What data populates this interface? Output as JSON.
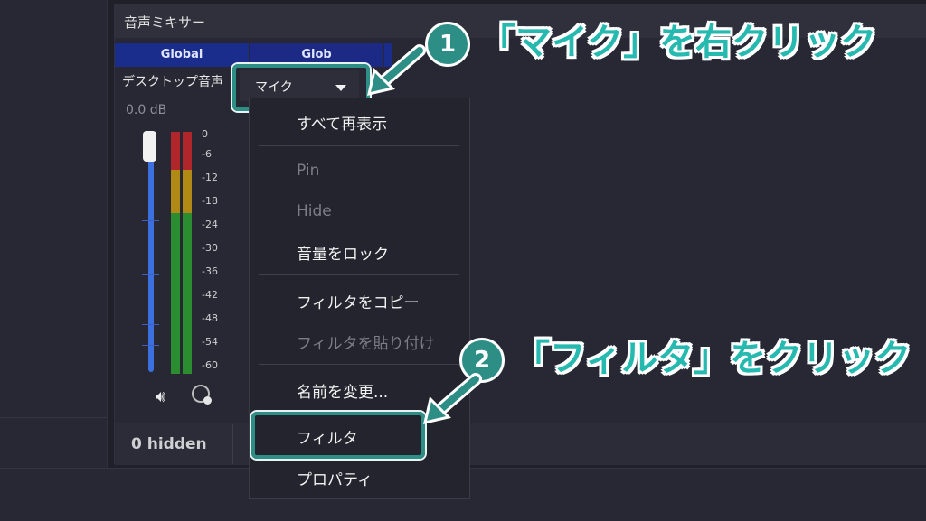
{
  "mixer": {
    "title": "音声ミキサー",
    "tabs": [
      "Global",
      "Glob"
    ],
    "channel_name": "デスクトップ音声",
    "db_level": "0.0 dB",
    "meter_scale": [
      "0",
      "-6",
      "-12",
      "-18",
      "-24",
      "-30",
      "-36",
      "-42",
      "-48",
      "-54",
      "-60"
    ],
    "hidden_count": "0 hidden"
  },
  "dropdown": {
    "value": "マイク"
  },
  "context_menu": {
    "items": [
      "すべて再表示",
      "Pin",
      "Hide",
      "音量をロック",
      "フィルタをコピー",
      "フィルタを貼り付け",
      "名前を変更...",
      "フィルタ",
      "プロパティ"
    ]
  },
  "annotations": {
    "step1_badge": "1",
    "step1_text": "「マイク」を右クリック",
    "step2_badge": "2",
    "step2_text": "「フィルタ」をクリック"
  },
  "colors": {
    "accent_teal": "#2d8e86",
    "annotation_text": "#25b9b0",
    "tab_blue": "#1a2c8c",
    "fader_blue": "#3c6fe0"
  }
}
